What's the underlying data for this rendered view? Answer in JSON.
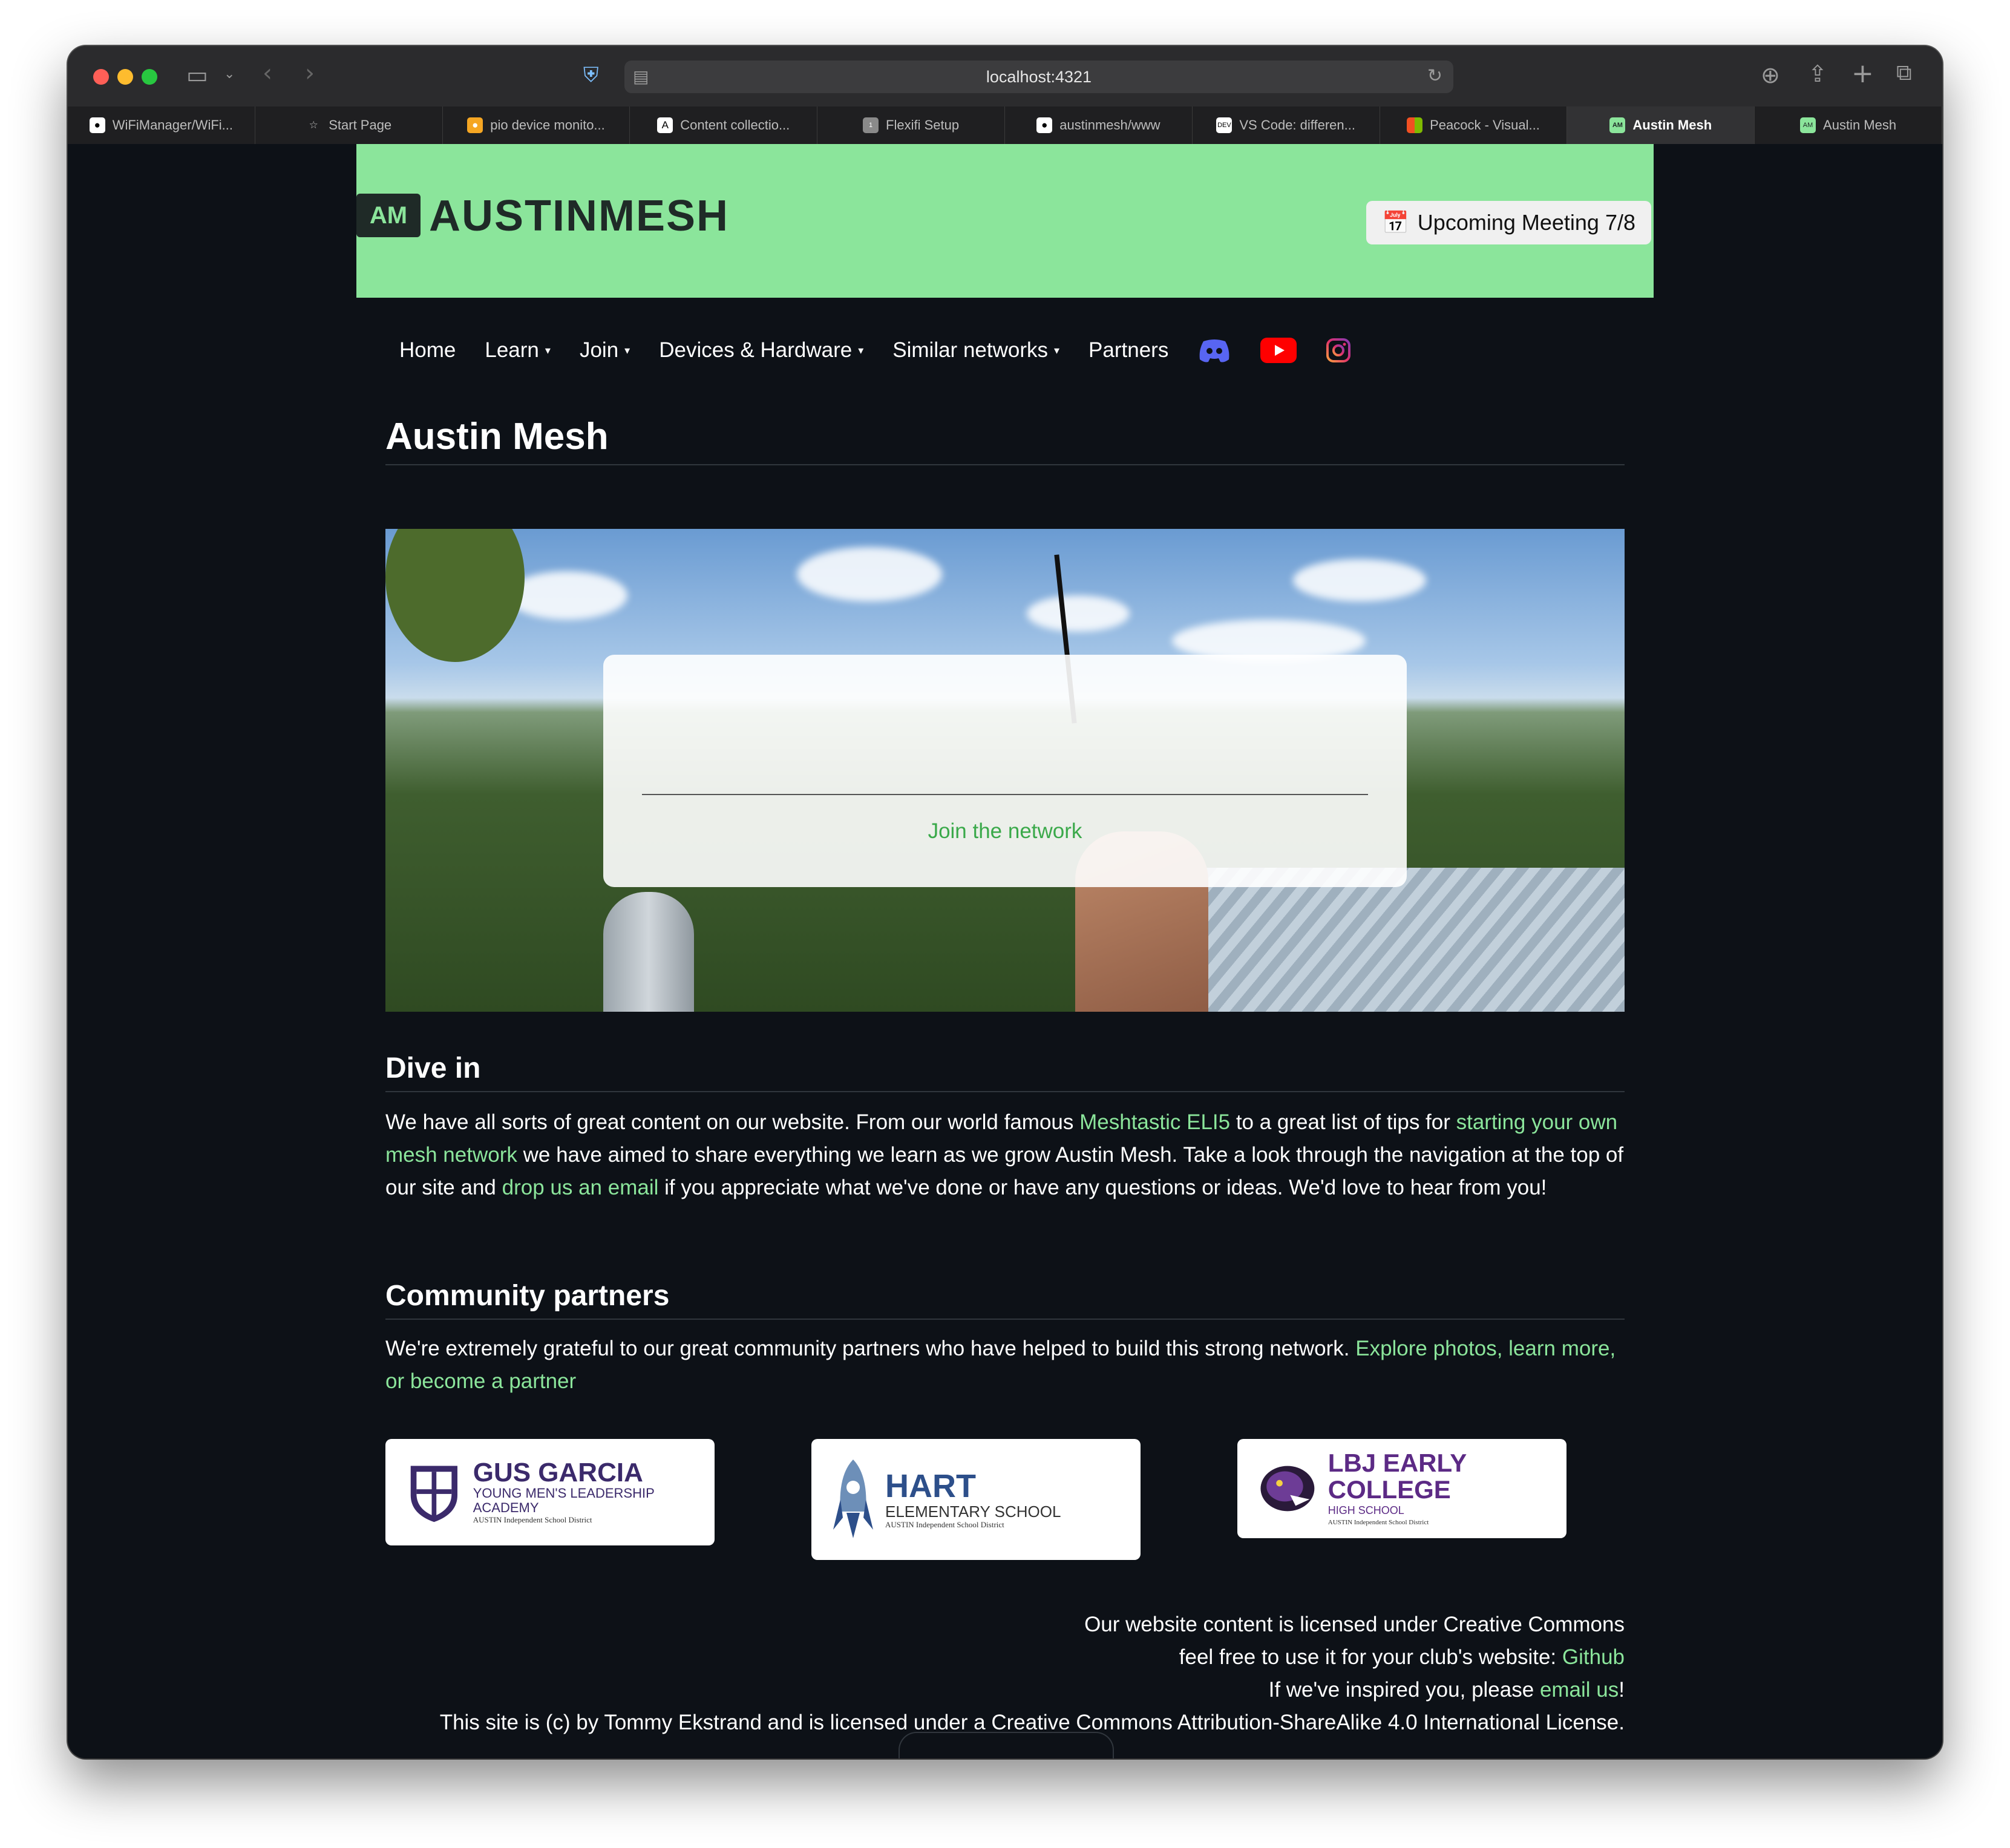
{
  "browser": {
    "url": "localhost:4321",
    "tabs": [
      {
        "label": "WiFiManager/WiFi...",
        "icon": "github-icon"
      },
      {
        "label": "Start Page",
        "icon": "star-icon"
      },
      {
        "label": "pio device monito...",
        "icon": "platformio-icon"
      },
      {
        "label": "Content collectio...",
        "icon": "astro-icon"
      },
      {
        "label": "Flexifi Setup",
        "icon": "number-badge-icon",
        "badge": "1"
      },
      {
        "label": "austinmesh/www",
        "icon": "github-icon"
      },
      {
        "label": "VS Code: differen...",
        "icon": "dev-icon",
        "badge": "DEV"
      },
      {
        "label": "Peacock - Visual...",
        "icon": "microsoft-icon"
      },
      {
        "label": "Austin Mesh",
        "icon": "austinmesh-icon",
        "active": true
      },
      {
        "label": "Austin Mesh",
        "icon": "austinmesh-icon"
      }
    ]
  },
  "site": {
    "logo_mark": "AM",
    "logo_text": "AUSTINMESH",
    "meeting": {
      "emoji": "📅",
      "label": "Upcoming Meeting 7/8"
    },
    "nav": [
      {
        "label": "Home",
        "dropdown": false
      },
      {
        "label": "Learn",
        "dropdown": true
      },
      {
        "label": "Join",
        "dropdown": true
      },
      {
        "label": "Devices & Hardware",
        "dropdown": true
      },
      {
        "label": "Similar networks",
        "dropdown": true
      },
      {
        "label": "Partners",
        "dropdown": false
      }
    ],
    "social": [
      "discord-icon",
      "youtube-icon",
      "instagram-icon"
    ],
    "colors": {
      "accent": "#8be59b",
      "background": "#0d1117",
      "join_link": "#3aa94a"
    }
  },
  "main": {
    "title": "Austin Mesh",
    "hero": {
      "join_label": "Join the network"
    },
    "dive_in": {
      "heading": "Dive in",
      "t1": "We have all sorts of great content on our website. From our world famous ",
      "link1": "Meshtastic ELI5",
      "t2": " to a great list of tips for ",
      "link2": "starting your own mesh network",
      "t3": " we have aimed to share everything we learn as we grow Austin Mesh. Take a look through the navigation at the top of our site and ",
      "link3": "drop us an email",
      "t4": " if you appreciate what we've done or have any questions or ideas. We'd love to hear from you!"
    },
    "community": {
      "heading": "Community partners",
      "text": "We're extremely grateful to our great community partners who have helped to build this strong network. ",
      "link": "Explore photos, learn more, or become a partner"
    },
    "partners": [
      {
        "name": "GUS GARCIA",
        "sub": "YOUNG MEN'S LEADERSHIP ACADEMY",
        "tiny": "AUSTIN Independent School District",
        "color": "#3b2a6b"
      },
      {
        "name": "HART",
        "sub": "ELEMENTARY SCHOOL",
        "tiny": "AUSTIN Independent School District",
        "color": "#2d4f8a"
      },
      {
        "name": "LBJ EARLY COLLEGE",
        "sub": "HIGH SCHOOL",
        "tiny": "AUSTIN Independent School District",
        "color": "#5c2a85"
      }
    ]
  },
  "footer": {
    "line1": "Our website content is licensed under Creative Commons",
    "line2_text": "feel free to use it for your club's website: ",
    "line2_link": "Github",
    "line3_text": "If we've inspired you, please ",
    "line3_link": "email us",
    "line3_end": "!",
    "line4": "This site is (c) by Tommy Ekstrand and is licensed under a Creative Commons Attribution-ShareAlike 4.0 International License."
  }
}
